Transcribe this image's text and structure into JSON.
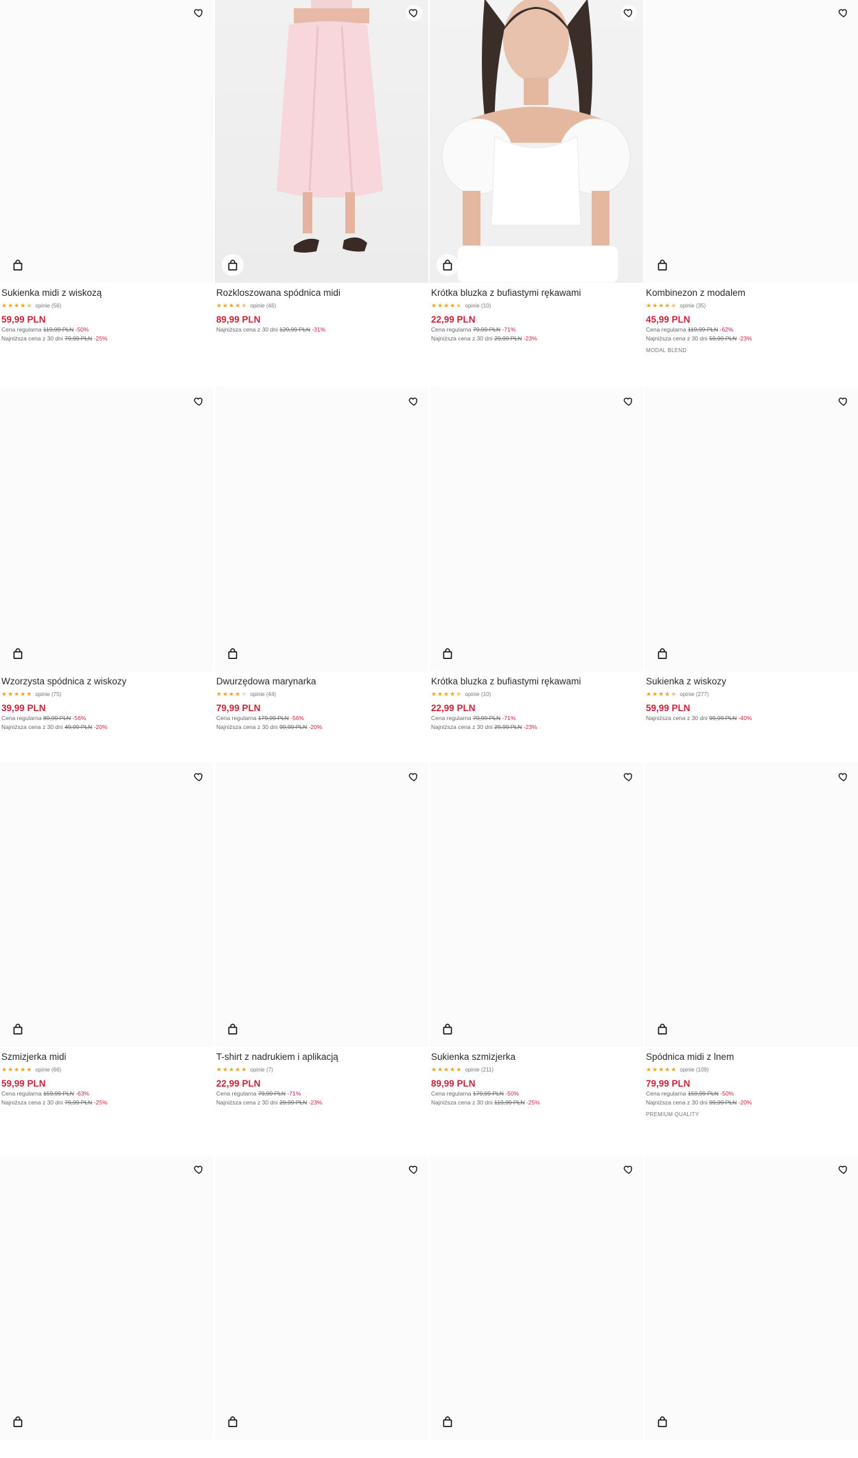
{
  "colors": {
    "price": "#c8243a",
    "star": "#f2a516"
  },
  "icons": {
    "favorite": "heart-outline-icon",
    "add_to_cart": "shopping-bag-icon"
  },
  "products": [
    {
      "name": "Sukienka midi z wiskozą",
      "stars": 4.5,
      "reviews": "opinie (56)",
      "price": "59,99 PLN",
      "regular_label": "Cena regularna",
      "regular_price": "119,99 PLN",
      "regular_disc": "-50%",
      "lowest_label": "Najniższa cena z 30 dni",
      "lowest_price": "79,99 PLN",
      "lowest_disc": "-25%",
      "tag": ""
    },
    {
      "name": "Rozkloszowana spódnica midi",
      "stars": 4.5,
      "reviews": "opinie (46)",
      "price": "89,99 PLN",
      "regular_label": "",
      "regular_price": "",
      "regular_disc": "",
      "lowest_label": "Najniższa cena z 30 dni",
      "lowest_price": "129,99 PLN",
      "lowest_disc": "-31%",
      "tag": ""
    },
    {
      "name": "Krótka bluzka z bufiastymi rękawami",
      "stars": 4.5,
      "reviews": "opinie (10)",
      "price": "22,99 PLN",
      "regular_label": "Cena regularna",
      "regular_price": "79,99 PLN",
      "regular_disc": "-71%",
      "lowest_label": "Najniższa cena z 30 dni",
      "lowest_price": "29,99 PLN",
      "lowest_disc": "-23%",
      "tag": ""
    },
    {
      "name": "Kombinezon z modalem",
      "stars": 4.5,
      "reviews": "opinie (35)",
      "price": "45,99 PLN",
      "regular_label": "Cena regularna",
      "regular_price": "119,99 PLN",
      "regular_disc": "-62%",
      "lowest_label": "Najniższa cena z 30 dni",
      "lowest_price": "59,99 PLN",
      "lowest_disc": "-23%",
      "tag": "MODAL BLEND"
    },
    {
      "name": "Wzorzysta spódnica z wiskozy",
      "stars": 5,
      "reviews": "opinie (75)",
      "price": "39,99 PLN",
      "regular_label": "Cena regularna",
      "regular_price": "89,99 PLN",
      "regular_disc": "-56%",
      "lowest_label": "Najniższa cena z 30 dni",
      "lowest_price": "49,99 PLN",
      "lowest_disc": "-20%",
      "tag": ""
    },
    {
      "name": "Dwurzędowa marynarka",
      "stars": 4,
      "reviews": "opinie (44)",
      "price": "79,99 PLN",
      "regular_label": "Cena regularna",
      "regular_price": "179,99 PLN",
      "regular_disc": "-56%",
      "lowest_label": "Najniższa cena z 30 dni",
      "lowest_price": "99,99 PLN",
      "lowest_disc": "-20%",
      "tag": ""
    },
    {
      "name": "Krótka bluzka z bufiastymi rękawami",
      "stars": 4.5,
      "reviews": "opinie (10)",
      "price": "22,99 PLN",
      "regular_label": "Cena regularna",
      "regular_price": "79,99 PLN",
      "regular_disc": "-71%",
      "lowest_label": "Najniższa cena z 30 dni",
      "lowest_price": "29,99 PLN",
      "lowest_disc": "-23%",
      "tag": ""
    },
    {
      "name": "Sukienka z wiskozy",
      "stars": 4.5,
      "reviews": "opinie (277)",
      "price": "59,99 PLN",
      "regular_label": "",
      "regular_price": "",
      "regular_disc": "",
      "lowest_label": "Najniższa cena z 30 dni",
      "lowest_price": "99,99 PLN",
      "lowest_disc": "-40%",
      "tag": ""
    },
    {
      "name": "Szmizjerka midi",
      "stars": 5,
      "reviews": "opinie (66)",
      "price": "59,99 PLN",
      "regular_label": "Cena regularna",
      "regular_price": "159,99 PLN",
      "regular_disc": "-63%",
      "lowest_label": "Najniższa cena z 30 dni",
      "lowest_price": "79,99 PLN",
      "lowest_disc": "-25%",
      "tag": ""
    },
    {
      "name": "T-shirt z nadrukiem i aplikacją",
      "stars": 5,
      "reviews": "opinie (7)",
      "price": "22,99 PLN",
      "regular_label": "Cena regularna",
      "regular_price": "79,99 PLN",
      "regular_disc": "-71%",
      "lowest_label": "Najniższa cena z 30 dni",
      "lowest_price": "29,99 PLN",
      "lowest_disc": "-23%",
      "tag": ""
    },
    {
      "name": "Sukienka szmizjerka",
      "stars": 5,
      "reviews": "opinie (211)",
      "price": "89,99 PLN",
      "regular_label": "Cena regularna",
      "regular_price": "179,99 PLN",
      "regular_disc": "-50%",
      "lowest_label": "Najniższa cena z 30 dni",
      "lowest_price": "119,99 PLN",
      "lowest_disc": "-25%",
      "tag": ""
    },
    {
      "name": "Spódnica midi z lnem",
      "stars": 5,
      "reviews": "opinie (109)",
      "price": "79,99 PLN",
      "regular_label": "Cena regularna",
      "regular_price": "159,99 PLN",
      "regular_disc": "-50%",
      "lowest_label": "Najniższa cena z 30 dni",
      "lowest_price": "99,99 PLN",
      "lowest_disc": "-20%",
      "tag": "PREMIUM QUALITY"
    },
    {
      "name": "",
      "stars": 0,
      "reviews": "",
      "price": "",
      "regular_label": "",
      "regular_price": "",
      "regular_disc": "",
      "lowest_label": "",
      "lowest_price": "",
      "lowest_disc": "",
      "tag": ""
    },
    {
      "name": "",
      "stars": 0,
      "reviews": "",
      "price": "",
      "regular_label": "",
      "regular_price": "",
      "regular_disc": "",
      "lowest_label": "",
      "lowest_price": "",
      "lowest_disc": "",
      "tag": ""
    },
    {
      "name": "",
      "stars": 0,
      "reviews": "",
      "price": "",
      "regular_label": "",
      "regular_price": "",
      "regular_disc": "",
      "lowest_label": "",
      "lowest_price": "",
      "lowest_disc": "",
      "tag": ""
    },
    {
      "name": "",
      "stars": 0,
      "reviews": "",
      "price": "",
      "regular_label": "",
      "regular_price": "",
      "regular_disc": "",
      "lowest_label": "",
      "lowest_price": "",
      "lowest_disc": "",
      "tag": ""
    }
  ]
}
